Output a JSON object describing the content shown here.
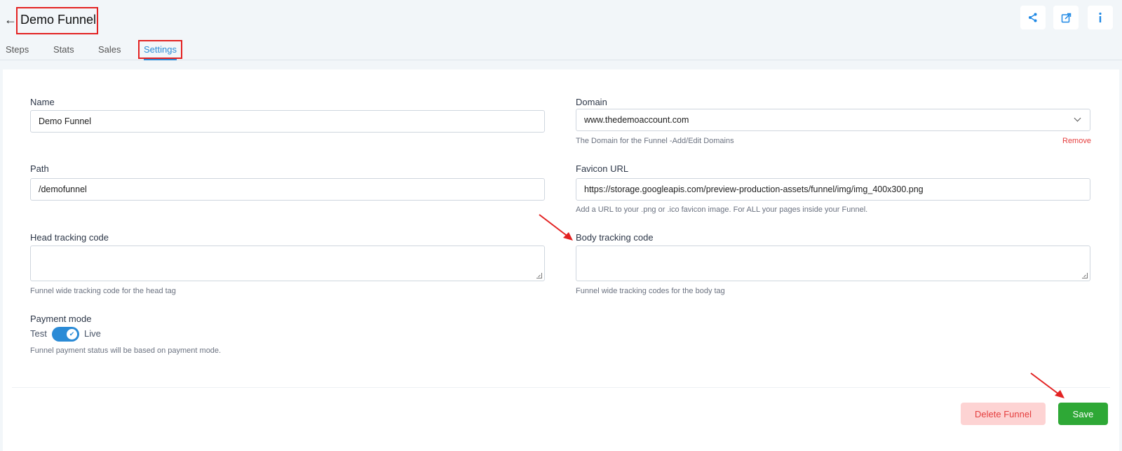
{
  "header": {
    "back_icon": "←",
    "title": "Demo Funnel",
    "actions": {
      "share_icon": "share-icon",
      "external_icon": "external-link-icon",
      "info_icon": "info-icon"
    }
  },
  "tabs": [
    {
      "label": "Steps"
    },
    {
      "label": "Stats"
    },
    {
      "label": "Sales"
    },
    {
      "label": "Settings"
    }
  ],
  "form": {
    "name": {
      "label": "Name",
      "value": "Demo Funnel"
    },
    "domain": {
      "label": "Domain",
      "value": "www.thedemoaccount.com",
      "hint": "The Domain for the Funnel -Add/Edit Domains",
      "remove": "Remove"
    },
    "path": {
      "label": "Path",
      "value": "/demofunnel"
    },
    "favicon": {
      "label": "Favicon URL",
      "value": "https://storage.googleapis.com/preview-production-assets/funnel/img/img_400x300.png",
      "hint": "Add a URL to your .png or .ico favicon image. For ALL your pages inside your Funnel."
    },
    "head_tracking": {
      "label": "Head tracking code",
      "hint": "Funnel wide tracking code for the head tag"
    },
    "body_tracking": {
      "label": "Body tracking code",
      "hint": "Funnel wide tracking codes for the body tag"
    },
    "payment_mode": {
      "label": "Payment mode",
      "test": "Test",
      "live": "Live",
      "hint": "Funnel payment status will be based on payment mode."
    }
  },
  "footer": {
    "delete_label": "Delete Funnel",
    "save_label": "Save"
  },
  "colors": {
    "accent": "#2b8bd6",
    "save": "#2ea836",
    "delete_bg": "#fdd3d3",
    "annotation": "#e32222"
  }
}
